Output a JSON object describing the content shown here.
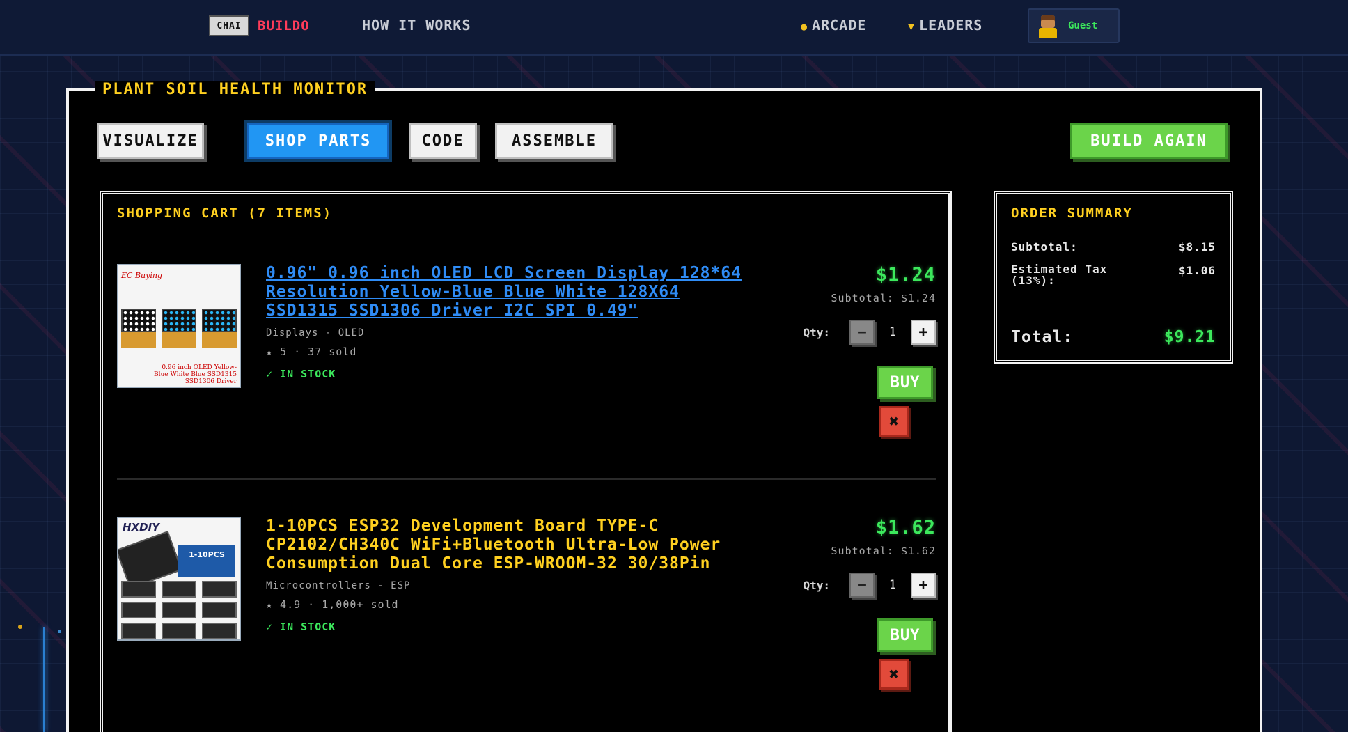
{
  "nav": {
    "logo_mark": "CHAI",
    "logo_text": "BUILDO",
    "how_it_works": "HOW IT WORKS",
    "arcade": "ARCADE",
    "leaders": "LEADERS",
    "user": "Guest"
  },
  "project": {
    "title": "PLANT SOIL HEALTH MONITOR",
    "tabs": [
      "VISUALIZE",
      "SHOP PARTS",
      "CODE",
      "ASSEMBLE"
    ],
    "active_tab": "SHOP PARTS",
    "build_again": "BUILD AGAIN"
  },
  "cart": {
    "title": "SHOPPING CART (7 ITEMS)",
    "items": [
      {
        "title": "0.96\" 0.96 inch OLED LCD Screen Display 128*64 Resolution Yellow-Blue Blue White 128X64 SSD1315 SSD1306 Driver I2C SPI 0.49\"",
        "category": "Displays - OLED",
        "rating": "★ 5 · 37 sold",
        "stock": "✓ IN STOCK",
        "price": "$1.24",
        "subtotal": "Subtotal: $1.24",
        "qty_label": "Qty:",
        "qty": "1",
        "buy": "BUY",
        "thumb_brand": "EC Buying",
        "thumb_caption": "0.96 inch OLED Yellow-Blue White Blue SSD1315 SSD1306 Driver"
      },
      {
        "title": "1-10PCS ESP32 Development Board TYPE-C CP2102/CH340C WiFi+Bluetooth Ultra-Low Power Consumption Dual Core ESP-WROOM-32 30/38Pin",
        "category": "Microcontrollers - ESP",
        "rating": "★ 4.9 · 1,000+ sold",
        "stock": "✓ IN STOCK",
        "price": "$1.62",
        "subtotal": "Subtotal: $1.62",
        "qty_label": "Qty:",
        "qty": "1",
        "buy": "BUY",
        "thumb_brand": "HXDIY",
        "thumb_tag": "1-10PCS"
      }
    ]
  },
  "summary": {
    "title": "ORDER SUMMARY",
    "subtotal_label": "Subtotal:",
    "subtotal": "$8.15",
    "tax_label": "Estimated Tax (13%):",
    "tax": "$1.06",
    "total_label": "Total:",
    "total": "$9.21"
  },
  "colors": {
    "accent_yellow": "#ffd020",
    "price_green": "#3ce85c",
    "active_tab_blue": "#2196f3",
    "link_blue": "#2f8cf6",
    "logo_red": "#ff3c5a"
  },
  "icons": {
    "arcade": "coin-icon",
    "leaders": "trophy-icon",
    "remove": "close-icon",
    "minus": "minus-icon",
    "plus": "plus-icon"
  }
}
